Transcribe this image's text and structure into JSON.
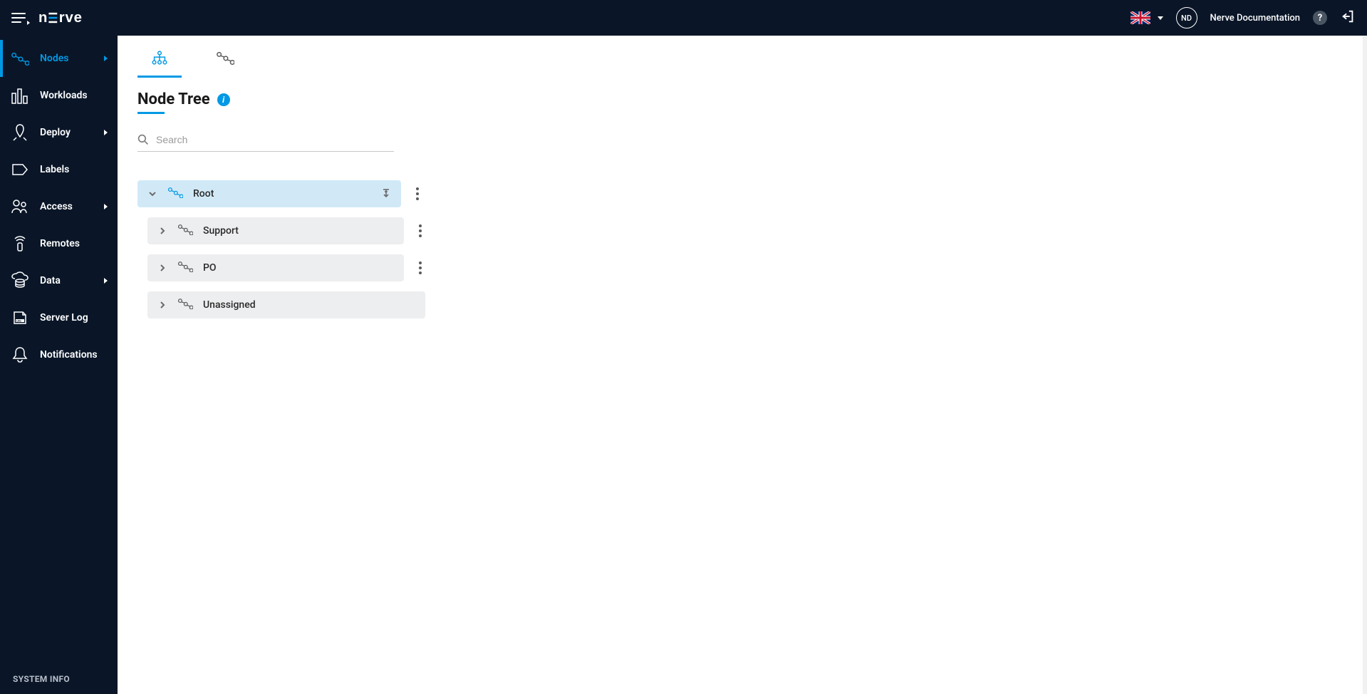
{
  "header": {
    "brand": "nerve",
    "user_initials": "ND",
    "user_name": "Nerve Documentation"
  },
  "sidebar": {
    "items": [
      {
        "label": "Nodes",
        "has_caret": true,
        "active": true
      },
      {
        "label": "Workloads",
        "has_caret": false,
        "active": false
      },
      {
        "label": "Deploy",
        "has_caret": true,
        "active": false
      },
      {
        "label": "Labels",
        "has_caret": false,
        "active": false
      },
      {
        "label": "Access",
        "has_caret": true,
        "active": false
      },
      {
        "label": "Remotes",
        "has_caret": false,
        "active": false
      },
      {
        "label": "Data",
        "has_caret": true,
        "active": false
      },
      {
        "label": "Server Log",
        "has_caret": false,
        "active": false
      },
      {
        "label": "Notifications",
        "has_caret": false,
        "active": false
      }
    ],
    "footer": "SYSTEM INFO"
  },
  "main": {
    "page_title": "Node Tree",
    "search_placeholder": "Search",
    "tree": {
      "root": "Root",
      "children": [
        {
          "label": "Support",
          "has_menu": true
        },
        {
          "label": "PO",
          "has_menu": true
        },
        {
          "label": "Unassigned",
          "has_menu": false
        }
      ]
    }
  }
}
